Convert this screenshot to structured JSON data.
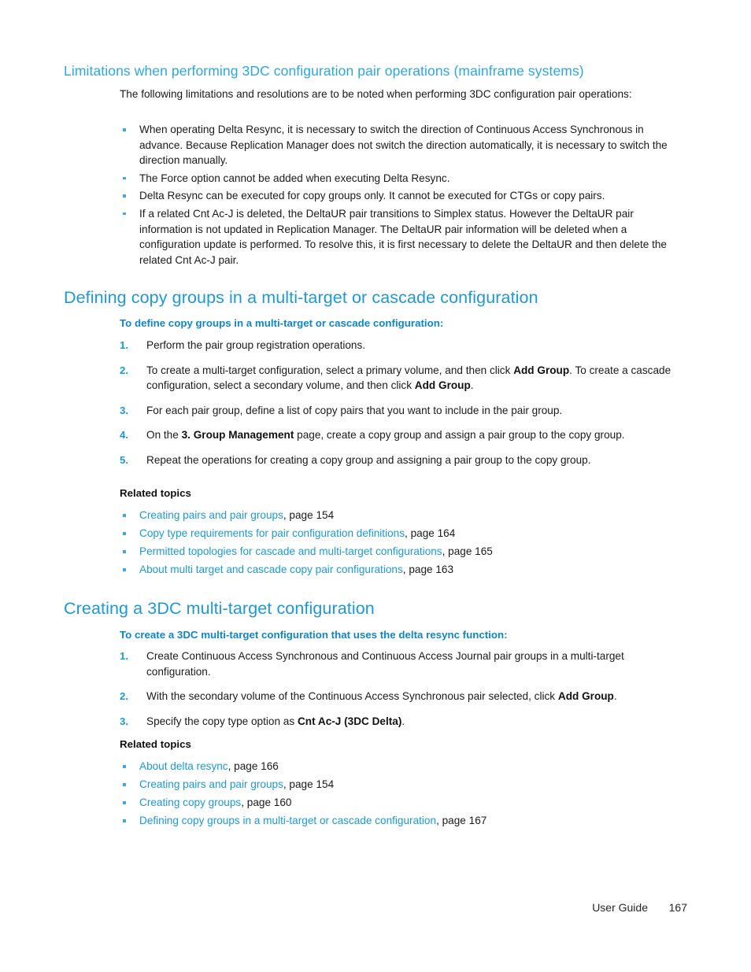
{
  "section1": {
    "heading": "Limitations when performing 3DC configuration pair operations (mainframe systems)",
    "intro": "The following limitations and resolutions are to be noted when performing 3DC configuration pair operations:",
    "bullets": [
      "When operating Delta Resync, it is necessary to switch the direction of Continuous Access Synchronous in advance. Because Replication Manager does not switch the direction automatically, it is necessary to switch the direction manually.",
      "The Force option cannot be added when executing Delta Resync.",
      "Delta Resync can be executed for copy groups only. It cannot be executed for CTGs or copy pairs.",
      "If a related Cnt Ac-J is deleted, the DeltaUR pair transitions to Simplex status. However the DeltaUR pair information is not updated in Replication Manager. The DeltaUR pair information will be deleted when a configuration update is performed. To resolve this, it is first necessary to delete the DeltaUR and then delete the related Cnt Ac-J pair."
    ]
  },
  "section2": {
    "heading": "Defining copy groups in a multi-target or cascade configuration",
    "procedure_heading": "To define copy groups in a multi-target or cascade configuration:",
    "steps": [
      {
        "num": "1.",
        "pre": "Perform the pair group registration operations.",
        "bold": "",
        "post": ""
      },
      {
        "num": "2.",
        "pre": "To create a multi-target configuration, select a primary volume, and then click ",
        "bold": "Add Group",
        "post": ". To create a cascade configuration, select a secondary volume, and then click ",
        "bold2": "Add Group",
        "post2": "."
      },
      {
        "num": "3.",
        "pre": "For each pair group, define a list of copy pairs that you want to include in the pair group.",
        "bold": "",
        "post": ""
      },
      {
        "num": "4.",
        "pre": "On the ",
        "bold": "3. Group Management",
        "post": " page, create a copy group and assign a pair group to the copy group."
      },
      {
        "num": "5.",
        "pre": "Repeat the operations for creating a copy group and assigning a pair group to the copy group.",
        "bold": "",
        "post": ""
      }
    ],
    "related_label": "Related topics",
    "related": [
      {
        "link": "Creating pairs and pair groups",
        "page": ", page 154"
      },
      {
        "link": "Copy type requirements for pair configuration definitions",
        "page": ", page 164"
      },
      {
        "link": "Permitted topologies for cascade and multi-target configurations",
        "page": ", page 165"
      },
      {
        "link": "About multi target and cascade copy pair configurations",
        "page": ", page 163"
      }
    ]
  },
  "section3": {
    "heading": "Creating a 3DC multi-target configuration",
    "procedure_heading": "To create a 3DC multi-target configuration that uses the delta resync function:",
    "steps": [
      {
        "num": "1.",
        "pre": "Create Continuous Access Synchronous and Continuous Access Journal pair groups in a multi-target configuration.",
        "bold": "",
        "post": ""
      },
      {
        "num": "2.",
        "pre": "With the secondary volume of the Continuous Access Synchronous pair selected, click ",
        "bold": "Add Group",
        "post": "."
      },
      {
        "num": "3.",
        "pre": "Specify the copy type option as ",
        "bold": "Cnt Ac-J (3DC Delta)",
        "post": "."
      }
    ],
    "related_label": "Related topics",
    "related": [
      {
        "link": "About delta resync",
        "page": ", page 166"
      },
      {
        "link": "Creating pairs and pair groups",
        "page": ", page 154"
      },
      {
        "link": "Creating copy groups",
        "page": ", page 160"
      },
      {
        "link": "Defining copy groups in a multi-target or cascade configuration",
        "page": ", page 167"
      }
    ]
  },
  "footer": {
    "guide": "User Guide",
    "page_number": "167"
  },
  "colors": {
    "heading_main": "#1d9ad6",
    "heading_sub": "#2aa9e0",
    "procedure_heading": "#0f86c6",
    "link": "#1d9ad6",
    "bullet": "#3aabe0",
    "body_text": "#1a1a1a"
  }
}
